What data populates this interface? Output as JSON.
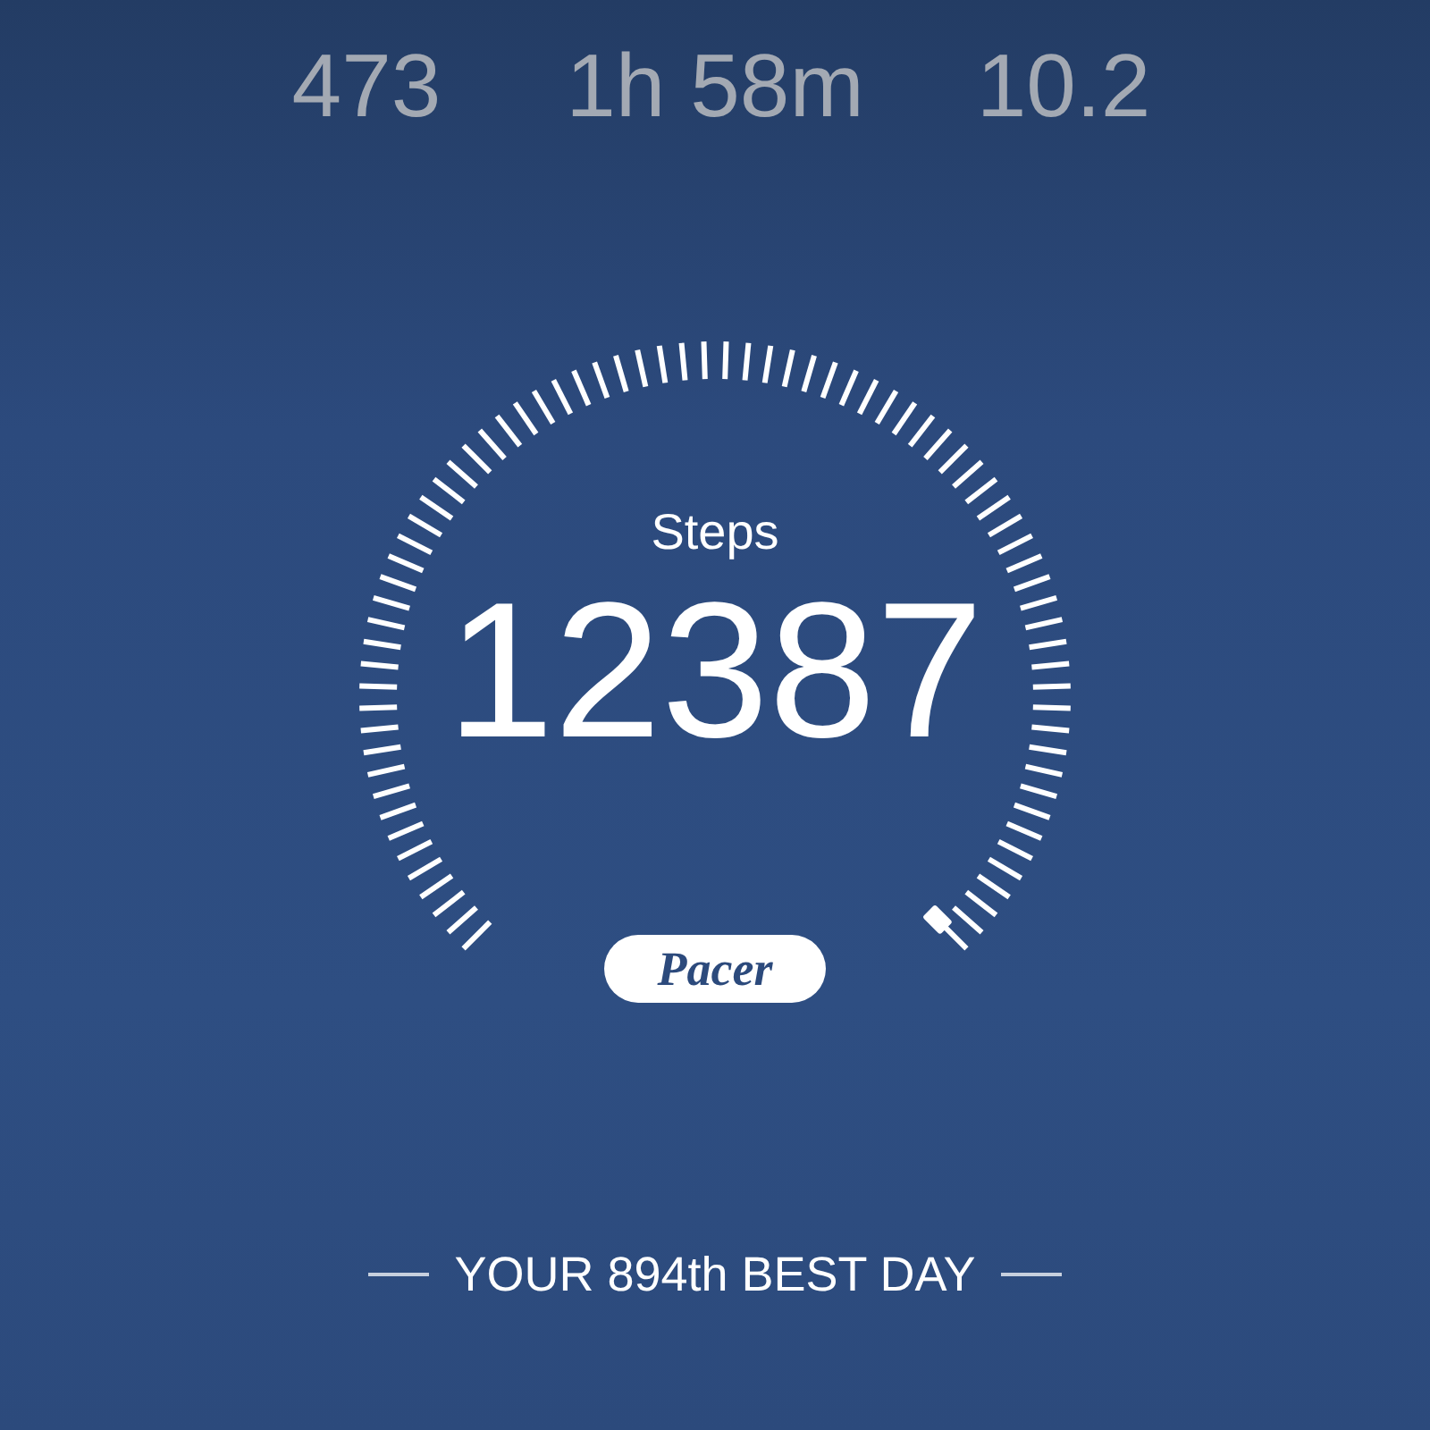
{
  "stats": [
    {
      "value": "473"
    },
    {
      "value": "1h 58m"
    },
    {
      "value": "10.2"
    }
  ],
  "gauge": {
    "label": "Steps",
    "value": "12387",
    "brand": "Pacer"
  },
  "tagline": "YOUR 894th BEST DAY"
}
